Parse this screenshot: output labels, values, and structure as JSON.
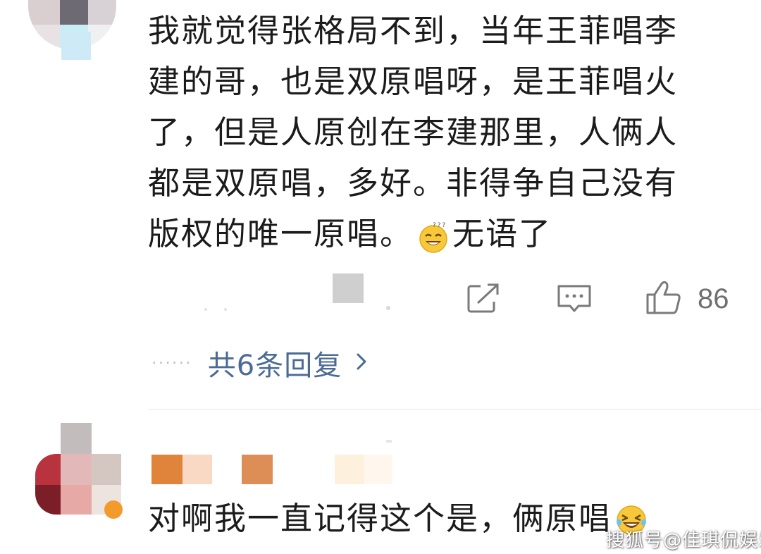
{
  "comment1": {
    "lines": [
      "我就觉得张格局不到，当年王菲唱李",
      "建的哥，也是双原唱呀，是王菲唱火",
      "了，但是人原创在李建那里，人俩人",
      "都是双原唱，多好。非得争自己没有",
      "版权的唯一原唱。"
    ],
    "tail_text": "无语了",
    "emoji_icon": "sweat-smile-emoji-icon",
    "like_count": "86"
  },
  "replies": {
    "dots": "······",
    "label": "共6条回复"
  },
  "comment2": {
    "text": "对啊我一直记得这个是，俩原唱",
    "emoji_icon": "laughing-tears-emoji-icon"
  },
  "watermark": "搜狐号@佳琪侃娱乐",
  "colors": {
    "text": "#1b1b1b",
    "link": "#4b6b95",
    "icon": "#7a7a7a",
    "count": "#6f6f6f"
  }
}
